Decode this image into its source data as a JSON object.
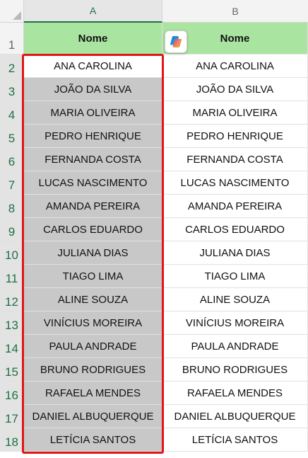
{
  "columns": [
    {
      "letter": "A"
    },
    {
      "letter": "B"
    }
  ],
  "row_numbers": [
    "1",
    "2",
    "3",
    "4",
    "5",
    "6",
    "7",
    "8",
    "9",
    "10",
    "11",
    "12",
    "13",
    "14",
    "15",
    "16",
    "17",
    "18"
  ],
  "header": {
    "a": "Nome",
    "b": "Nome"
  },
  "names_a": [
    "ANA CAROLINA",
    "JOÃO DA SILVA",
    "MARIA OLIVEIRA",
    "PEDRO HENRIQUE",
    "FERNANDA COSTA",
    "LUCAS NASCIMENTO",
    "AMANDA PEREIRA",
    "CARLOS EDUARDO",
    "JULIANA DIAS",
    "TIAGO LIMA",
    "ALINE SOUZA",
    "VINÍCIUS MOREIRA",
    "PAULA ANDRADE",
    "BRUNO RODRIGUES",
    "RAFAELA MENDES",
    "DANIEL ALBUQUERQUE",
    "LETÍCIA SANTOS"
  ],
  "names_b": [
    "ANA CAROLINA",
    "JOÃO DA SILVA",
    "MARIA OLIVEIRA",
    "PEDRO HENRIQUE",
    "FERNANDA COSTA",
    "LUCAS NASCIMENTO",
    "AMANDA PEREIRA",
    "CARLOS EDUARDO",
    "JULIANA DIAS",
    "TIAGO LIMA",
    "ALINE SOUZA",
    "VINÍCIUS MOREIRA",
    "PAULA ANDRADE",
    "BRUNO RODRIGUES",
    "RAFAELA MENDES",
    "DANIEL ALBUQUERQUE",
    "LETÍCIA SANTOS"
  ],
  "selection": {
    "range_start": "A2",
    "range_end": "A18",
    "active_cell": "A2"
  },
  "colors": {
    "header_fill": "#a9e4a0",
    "selection_fill": "#c8c8c8",
    "selection_outline": "#e01616",
    "excel_green": "#1e7145"
  },
  "icons": {
    "copilot": "copilot-icon"
  }
}
